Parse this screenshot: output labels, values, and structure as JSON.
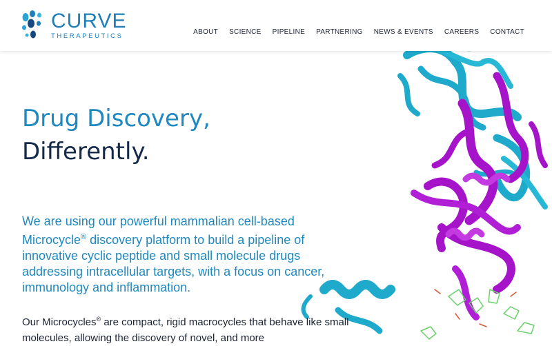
{
  "brand": {
    "name": "CURVE",
    "subtitle": "THERAPEUTICS",
    "color": "#1e7fb6"
  },
  "nav": {
    "items": [
      "ABOUT",
      "SCIENCE",
      "PIPELINE",
      "PARTNERING",
      "NEWS & EVENTS",
      "CAREERS",
      "CONTACT"
    ]
  },
  "hero": {
    "title_line1": "Drug Discovery,",
    "title_line2": "Differently.",
    "title_line1_color": "#1e88c0",
    "title_line2_color": "#15294b"
  },
  "intro": {
    "part1": "We are using our powerful mammalian cell-based Microcycle",
    "mark": "®",
    "part2": " discovery platform to build a pipeline of innovative cyclic peptide and small molecule drugs addressing intracellular targets, with a focus on cancer, immunology and inflammation."
  },
  "body": {
    "part1": "Our Microcycles",
    "mark": "®",
    "part2": " are compact, rigid macrocycles that behave like small molecules, allowing the discovery of novel, and more"
  },
  "art": {
    "icon": "protein-structure-illustration",
    "colors": {
      "cyan": "#1faacb",
      "magenta": "#a514c9",
      "green": "#6ad06a",
      "red": "#d9583a"
    }
  }
}
